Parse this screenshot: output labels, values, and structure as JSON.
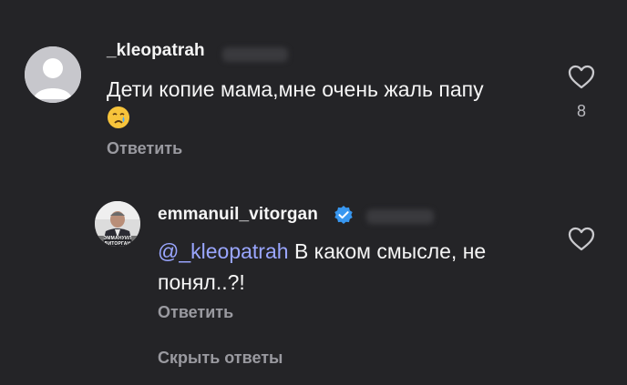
{
  "comment": {
    "username": "_kleopatrah",
    "text": "Дети копие мама,мне очень жаль папу",
    "reply_label": "Ответить",
    "likes": "8",
    "icons": {
      "avatar": "default-avatar-icon",
      "like": "heart-outline-icon",
      "emoji": "crying-face-emoji"
    }
  },
  "reply": {
    "username": "emmanuil_vitorgan",
    "mention": "@_kleopatrah",
    "text": " В каком смысле, не понял..?!",
    "reply_label": "Ответить",
    "avatar_caption": "ЭММАНУИЛ ВИТОРГАН",
    "icons": {
      "verified": "verified-badge-icon",
      "like": "heart-outline-icon"
    }
  },
  "hide_replies_label": "Скрыть ответы",
  "colors": {
    "background": "#242427",
    "text": "#f5f5f5",
    "secondary": "#9a9aa0",
    "mention": "#9aa6ff",
    "verified": "#3897f0"
  }
}
